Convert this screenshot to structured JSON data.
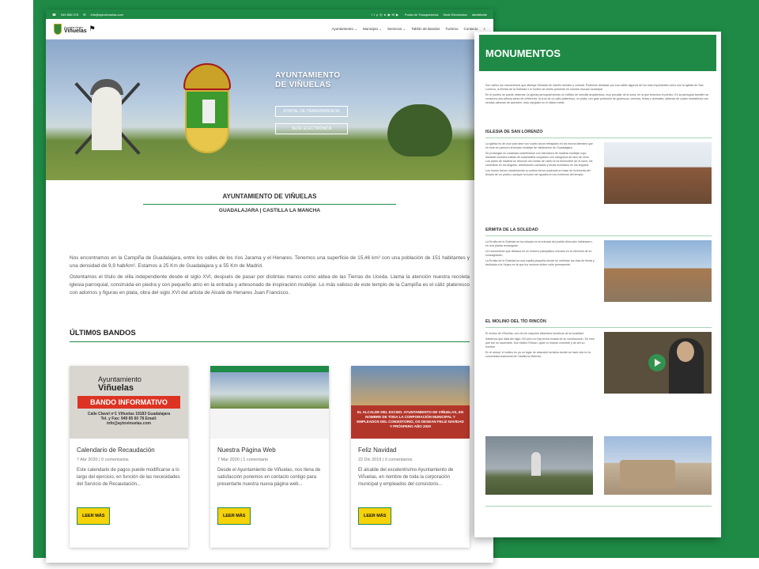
{
  "left_page": {
    "topbar": {
      "phone": "949 856 078",
      "email": "info@aytovinuelas.com",
      "icons": [
        "facebook-icon",
        "twitter-icon",
        "pinterest-icon",
        "instagram-icon",
        "flickr-icon",
        "whatsapp-icon",
        "email-icon",
        "youtube-icon"
      ],
      "links": [
        "Portal de Transparencia",
        "Sede Electrónica",
        "Identificate"
      ]
    },
    "logo": {
      "small": "Ayuntamiento",
      "name": "Viñuelas"
    },
    "menu": [
      "Ayuntamiento ⌄",
      "Municipio ⌄",
      "Servicios ⌄",
      "Tablón de Bandos",
      "Turismo",
      "Contacto"
    ],
    "hero": {
      "title_line1": "AYUNTAMIENTO",
      "title_line2": "DE VIÑUELAS",
      "btn_transparencia": "PORTAL DE TRANSPARENCIA",
      "btn_sede": "SEDE ELECTRÓNICA"
    },
    "intro": {
      "title": "AYUNTAMIENTO DE VIÑUELAS",
      "subtitle": "GUADALAJARA | CASTILLA LA MANCHA",
      "p1": "Nos encontramos en la Campiña de Guadalajara, entre los valles de los ríos Jarama y el Henares. Tenemos una superficie de 15,46 km² con una población de 151 habitantes y una densidad de 9,9 hab/km². Estamos a 25 Km de Guadalajara y a 55 Km de Madrid.",
      "p2": "Ostentamos el título de villa independiente desde el siglo XVI, después de pasar por distintas manos como aldea de las Tierras de Uceda. Llama la atención nuestra recoleta iglesia parroquial, construida en piedra y con pequeño atrio en la entrada y artesonado de inspiración mudéjar. Lo más valioso de este templo de la Campiña es el cáliz plateresco con adornos y figuras en plata, obra del siglo XVI del artista de Alcalá de Henares Juan Francisco."
    },
    "bandos_title": "ÚLTIM0S BANDOS",
    "cards": [
      {
        "img_logo_small": "Ayuntamiento",
        "img_logo_name": "Viñuelas",
        "img_banner": "BANDO INFORMATIVO",
        "img_addr": "Calle Clavel nº1 Viñuelas 19183 Guadalajara Tel. y Fax: 949 85 60 78 Email: info@aytovinuelas.com",
        "title": "Calendario de Recaudación",
        "meta": "7 Abr 2020 | 0 comentarios",
        "excerpt": "Este calendario de pagos puede modificarse a lo largo del ejercicio, en función de las necesidades del Servicio de Recaudación...",
        "button": "LEER MÁS"
      },
      {
        "title": "Nuestra Página Web",
        "meta": "7 Mar 2020 | 1 comentario",
        "excerpt": "Desde el Ayuntamiento de Viñuelas, nos llena de satisfacción ponemos en contacto contigo para presentarte nuestra nueva página web...",
        "button": "LEER MÁS"
      },
      {
        "img_text": "EL ALCALDE DEL EXCMO. AYUNTAMIENTO DE VIÑUELAS, EN NOMBRE DE TODA LA CORPORACIÓN MUNICIPAL Y EMPLEADOS DEL CONSISTORIO, OS DESEAN FELIZ NAVIDAD Y PRÓSPERO AÑO 2020",
        "title": "Feliz Navidad",
        "meta": "22 Dic 2019 | 0 comentarios",
        "excerpt": "El alcalde del excelentísimo Ayuntamiento de Viñuelas, en nombre de toda la corporación municipal y empleados del consistorio...",
        "button": "LEER MÁS"
      }
    ]
  },
  "right_page": {
    "header": "MONUMENTOS",
    "intro_p1": "Son varios los monumentos que alberga Viñuelas de interés turístico y cultural. Podemos destacar por sus calles algunos de los más importantes como son la Iglesia de San Lorenzo, la Ermita de la Soledad o el molino de viento presente en nuestro escudo municipal.",
    "intro_p2": "En el pueblo se puede observar, la iglesia parroquial siendo un edificio de sencilla arquitectura, muy peculiar de la zona, en la que tenemos el pórtico. En la parroquia también se conserva una valiosa pieza de orfebrería: la cruz de un cáliz plateresco, en plata, con gran profusión de grutescos, veneras, frutas y animales, además de cuatro medallones con sendas cabezas de querubín, todo repujado en el citado metal.",
    "sections": [
      {
        "title": "IGLESIA DE SAN LORENZO",
        "p1": "La iglesia es de una sola nave con cuatro arcos rebajados en los muros laterales que en éste se parecen al templo mudéjar de Valdeavero de Guadalajara.",
        "p2": "Se prolongan en cuadrado cubriéndose con estructura de madera mudéjar cuyo almizate muestra mallas de cuadraditos ocupados con octógonos de lazo de ocho. Los pares de madera se decoran con cintas de vidrio en la techumbre de la nave; los canecillos en los ángulos, alrededores cobrados y tenas montados en los ángulos.",
        "p3": "Los muros fueron manteniendo su sobria forma cuadrada en base de la bóveda del templo de un pórtico, aunque no lucen ser iguales en los extremos del templo."
      },
      {
        "title": "ERMITA DE LA SOLEDAD",
        "p1": "La Ermita de la Soledad se ha situado en la entrada del pueblo dirección Valdeavero, en una planta rectangular.",
        "p2": "Un monumento que destaca en un entorno paisajístico cercano en la memoria de su consagración.",
        "p3": "La Ermita de la Soledad es una capilla pequeña donde se celebran los días de fiesta y dedicada a la Virgen en la que los vecinos rinden culto permanente."
      },
      {
        "title": "EL MOLINO DEL TÍO RINCÓN",
        "p1": "El molino de Viñuelas, uno de los mayores atractivos turísticos de la localidad.",
        "p2": "Sabemos que data del siglo XIX pero no hay fecha exacta de su construcción. Se cree que fue un sacerdote, Don Mateo Rincón, quien lo mandó construir y de ahí su nombre.",
        "p3": "En el actual, el molino es ya un lugar de atracción turística donde se hace cita en la comunidad autónoma de Castilla la Mancha."
      }
    ]
  }
}
